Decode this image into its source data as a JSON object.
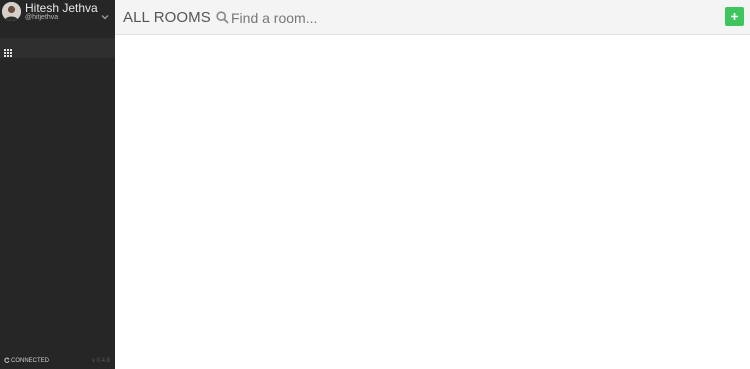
{
  "user": {
    "name": "Hitesh Jethva",
    "handle": "@hitjethva"
  },
  "sidebar": {
    "items": [
      {
        "icon": "grid-icon"
      }
    ],
    "status": "CONNECTED",
    "version": "v 0.4.8"
  },
  "header": {
    "title": "ALL ROOMS",
    "search_placeholder": "Find a room...",
    "add_icon": "plus-icon"
  },
  "colors": {
    "sidebar_bg": "#262626",
    "header_bg": "#f4f4f4",
    "accent_green": "#3fc55e"
  }
}
